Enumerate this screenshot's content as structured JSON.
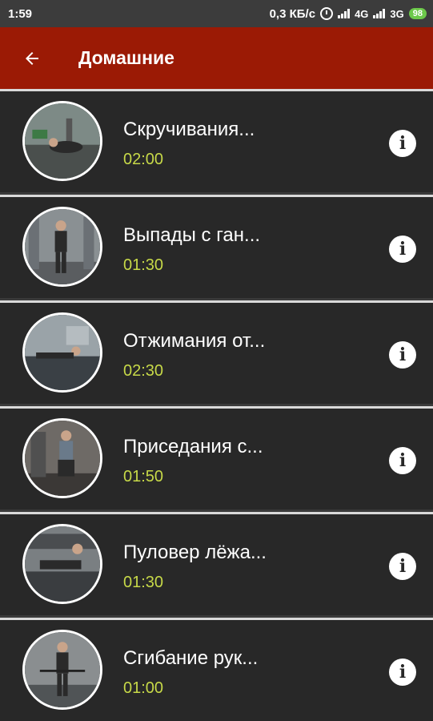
{
  "status_bar": {
    "time": "1:59",
    "speed": "0,3 КБ/с",
    "network1": "4G",
    "network2": "3G",
    "battery": "98",
    "battery_color": "#6cc94a"
  },
  "app_bar": {
    "title": "Домашние",
    "back_icon": "arrow-left-icon",
    "color": "#9b1a05"
  },
  "exercises": [
    {
      "name": "Скручивания...",
      "duration": "02:00",
      "info_icon": "info-icon"
    },
    {
      "name": "Выпады с ган...",
      "duration": "01:30",
      "info_icon": "info-icon"
    },
    {
      "name": "Отжимания от...",
      "duration": "02:30",
      "info_icon": "info-icon"
    },
    {
      "name": "Приседания с...",
      "duration": "01:50",
      "info_icon": "info-icon"
    },
    {
      "name": "Пуловер лёжа...",
      "duration": "01:30",
      "info_icon": "info-icon"
    },
    {
      "name": "Сгибание рук...",
      "duration": "01:00",
      "info_icon": "info-icon"
    }
  ],
  "colors": {
    "duration": "#c7d948",
    "row_background": "#282828",
    "divider": "#d9d9d9"
  }
}
